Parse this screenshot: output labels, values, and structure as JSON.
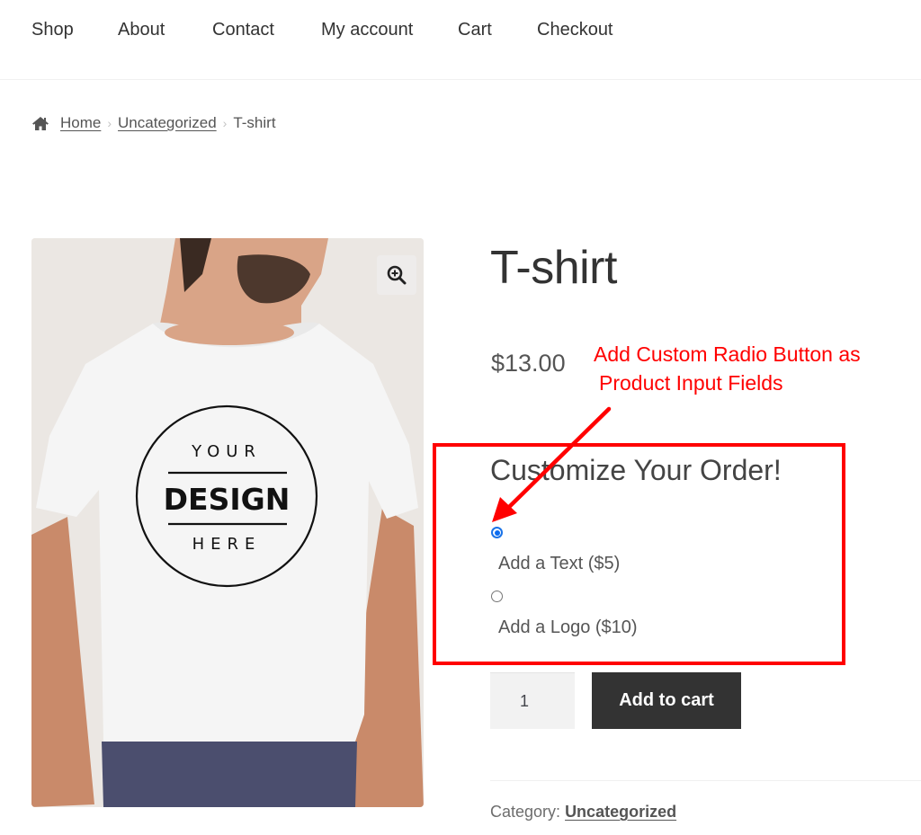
{
  "nav": {
    "items": [
      {
        "label": "Shop"
      },
      {
        "label": "About"
      },
      {
        "label": "Contact"
      },
      {
        "label": "My account"
      },
      {
        "label": "Cart"
      },
      {
        "label": "Checkout"
      }
    ]
  },
  "breadcrumb": {
    "icon": "home-icon",
    "items": [
      {
        "label": "Home"
      },
      {
        "label": "Uncategorized"
      },
      {
        "label": "T-shirt"
      }
    ],
    "separator": "›"
  },
  "product": {
    "image": {
      "alt": "Man wearing white T-shirt with logo",
      "print_lines": [
        "YOUR",
        "DESIGN",
        "HERE"
      ],
      "zoom_icon": "zoom-in-icon"
    },
    "title": "T-shirt",
    "price": "$13.00",
    "options": {
      "heading": "Customize Your Order!",
      "choices": [
        {
          "label": "Add a Text ($5)",
          "checked": true
        },
        {
          "label": "Add a Logo ($10)",
          "checked": false
        }
      ]
    },
    "quantity": "1",
    "add_to_cart_label": "Add to cart",
    "category_label": "Category:",
    "category_value": "Uncategorized"
  },
  "annotation": {
    "line1": "Add Custom Radio Button as",
    "line2": "Product Input Fields",
    "color": "#ff0000"
  },
  "colors": {
    "radio_checked": "#0b6cf0",
    "button_bg": "#333333",
    "annotation": "#ff0000"
  }
}
